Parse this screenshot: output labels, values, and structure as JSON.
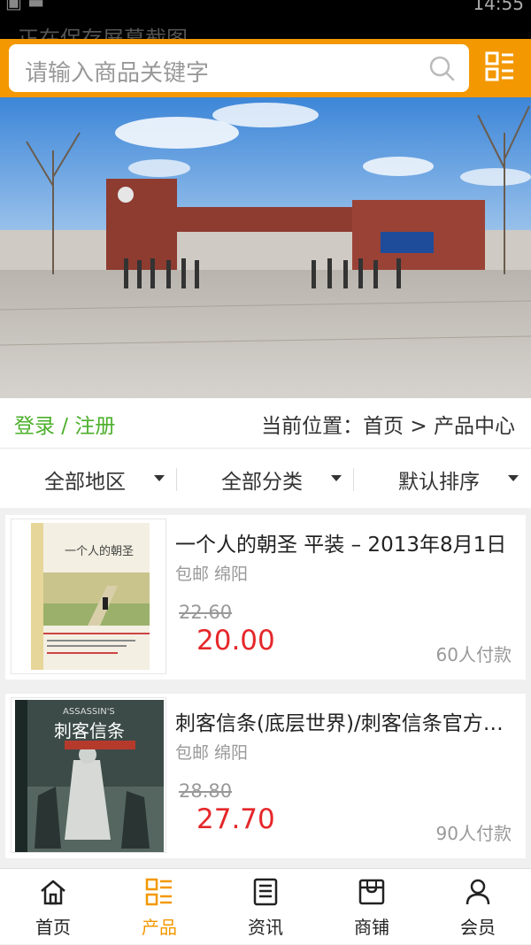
{
  "status_bar": {
    "notice": "正在保存屏幕截图...",
    "time": "14:55"
  },
  "search": {
    "placeholder": "请输入商品关键字"
  },
  "location_bar": {
    "login": "登录 / 注册",
    "breadcrumb": "当前位置：首页 > 产品中心"
  },
  "filters": [
    {
      "label": "全部地区"
    },
    {
      "label": "全部分类"
    },
    {
      "label": "默认排序"
    }
  ],
  "products": [
    {
      "title": "一个人的朝圣 平装 – 2013年8月1日",
      "shipping": "包邮 绵阳",
      "old_price": "22.60",
      "price": "20.00",
      "paid": "60人付款",
      "cover_title": "一个人的朝圣"
    },
    {
      "title": "刺客信条(底层世界)/刺客信条官方小说",
      "shipping": "包邮 绵阳",
      "old_price": "28.80",
      "price": "27.70",
      "paid": "90人付款",
      "cover_title": "刺客信条",
      "cover_brand": "ASSASSIN'S"
    }
  ],
  "tabs": [
    {
      "label": "首页",
      "icon": "home-icon"
    },
    {
      "label": "产品",
      "icon": "product-icon"
    },
    {
      "label": "资讯",
      "icon": "news-icon"
    },
    {
      "label": "商铺",
      "icon": "store-icon"
    },
    {
      "label": "会员",
      "icon": "member-icon"
    }
  ],
  "colors": {
    "accent": "#f39800",
    "price": "#e5272a",
    "login": "#4caf2a"
  }
}
